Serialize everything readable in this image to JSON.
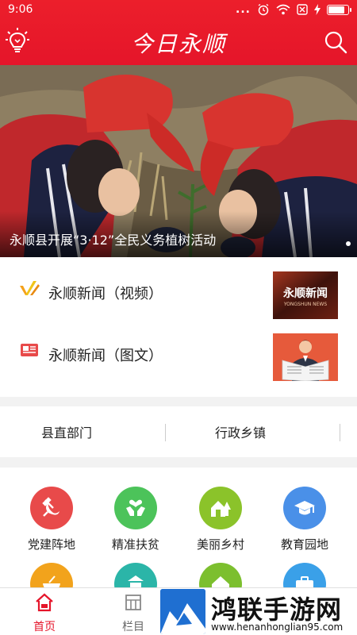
{
  "status_bar": {
    "time": "9:06",
    "dots": "...",
    "battery_level": 0.85
  },
  "header": {
    "logo_text": "今日永顺"
  },
  "banner": {
    "caption": "永顺县开展“3·12”全民义务植树活动"
  },
  "news": [
    {
      "label": "永顺新闻（视频）",
      "icon": "v-logo-icon",
      "thumb_text": "永顺新闻",
      "thumb_subtext": "YONGSHUN NEWS"
    },
    {
      "label": "永顺新闻（图文）",
      "icon": "newspaper-icon"
    }
  ],
  "tabs": [
    {
      "label": "县直部门"
    },
    {
      "label": "行政乡镇"
    }
  ],
  "services": [
    {
      "name": "党建阵地",
      "color": "#e84a4a",
      "icon": "hammer-sickle-icon"
    },
    {
      "name": "精准扶贫",
      "color": "#4cc35a",
      "icon": "hands-heart-icon"
    },
    {
      "name": "美丽乡村",
      "color": "#8bc32a",
      "icon": "house-tree-icon"
    },
    {
      "name": "教育园地",
      "color": "#4a90e8",
      "icon": "graduation-cap-icon"
    }
  ],
  "bottom_nav": [
    {
      "label": "首页",
      "icon": "home-icon",
      "active": true
    },
    {
      "label": "栏目",
      "icon": "columns-icon",
      "active": false
    }
  ],
  "watermark": {
    "title": "鸿联手游网",
    "url": "www.henanhonglian95.com"
  },
  "colors": {
    "brand_red": "#e5152a"
  }
}
